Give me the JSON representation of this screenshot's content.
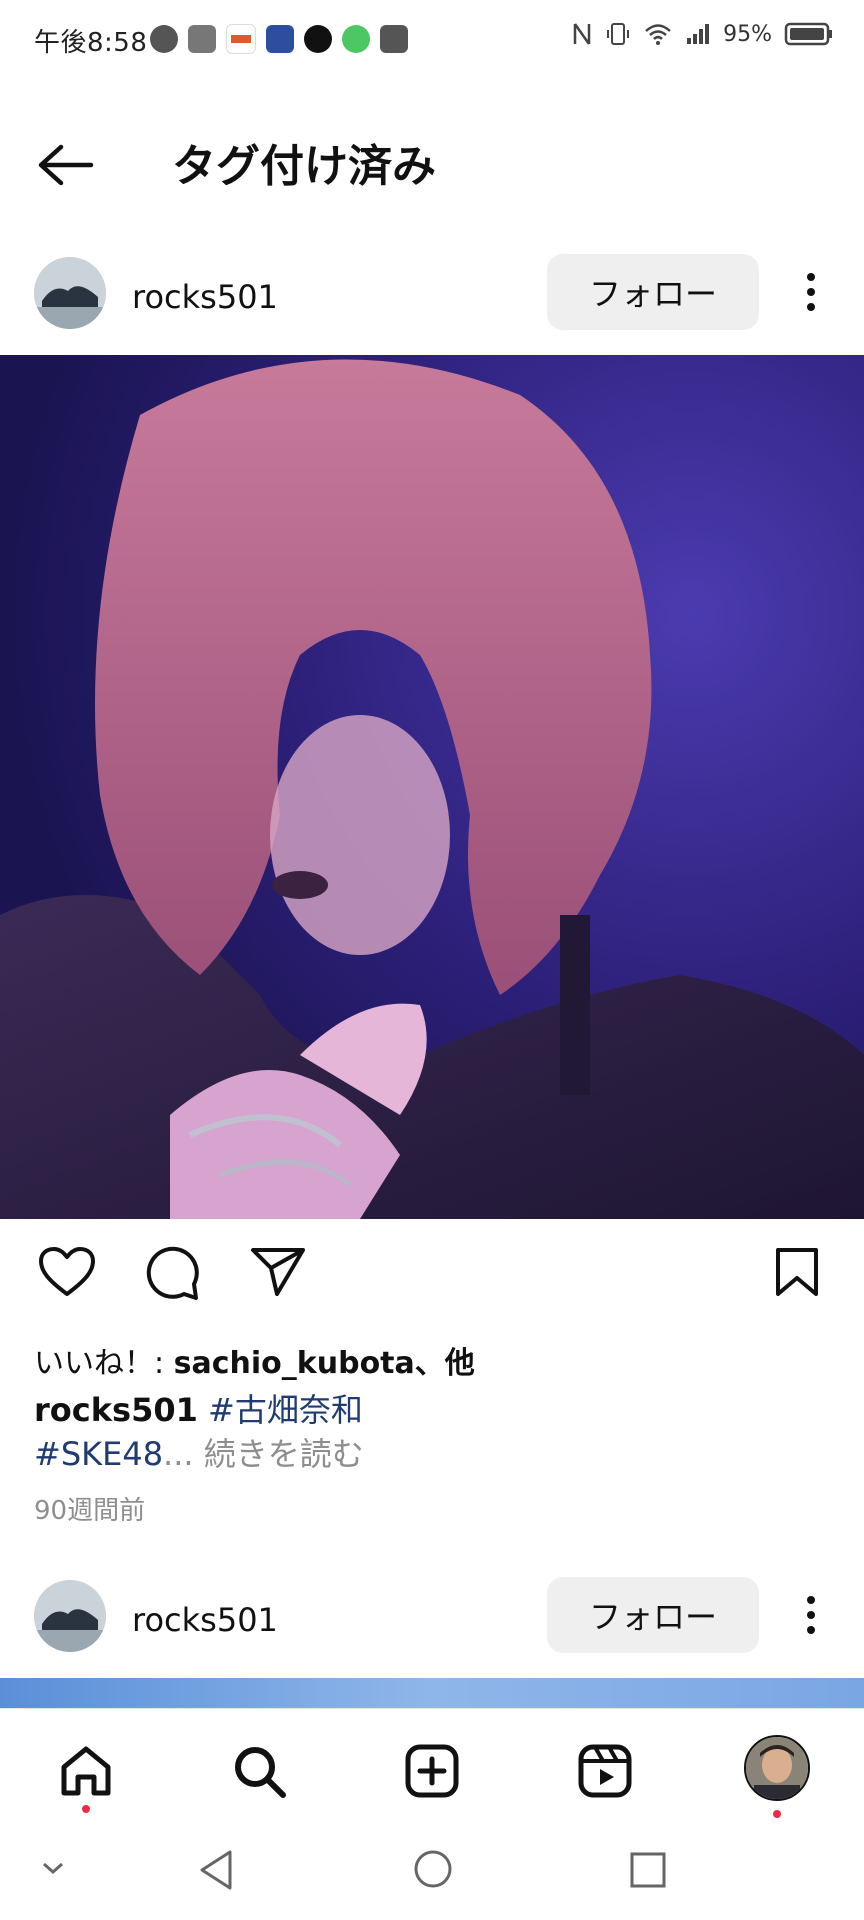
{
  "status_bar": {
    "time": "午後8:58",
    "battery": "95%"
  },
  "header": {
    "title": "タグ付け済み"
  },
  "posts": [
    {
      "username": "rocks501",
      "follow_label": "フォロー",
      "likes_prefix": "いいね！: ",
      "likes_user": "sachio_kubota",
      "likes_suffix": "、他",
      "caption_user": "rocks501",
      "caption_tag1": "#古畑奈和",
      "caption_tag2": "#SKE48",
      "caption_ellipsis": "...",
      "read_more": "続きを読む",
      "timestamp": "90週間前"
    },
    {
      "username": "rocks501",
      "follow_label": "フォロー"
    }
  ],
  "icons": {
    "back": "arrow-left-icon",
    "more": "more-vertical-icon",
    "like": "heart-icon",
    "comment": "comment-icon",
    "share": "send-icon",
    "save": "bookmark-icon",
    "home": "home-icon",
    "search": "search-icon",
    "create": "plus-square-icon",
    "reels": "reels-icon",
    "profile": "profile-avatar"
  },
  "colors": {
    "hashtag": "#1f3b70",
    "follow_bg": "#efefef",
    "notification_dot": "#ed2a45"
  }
}
